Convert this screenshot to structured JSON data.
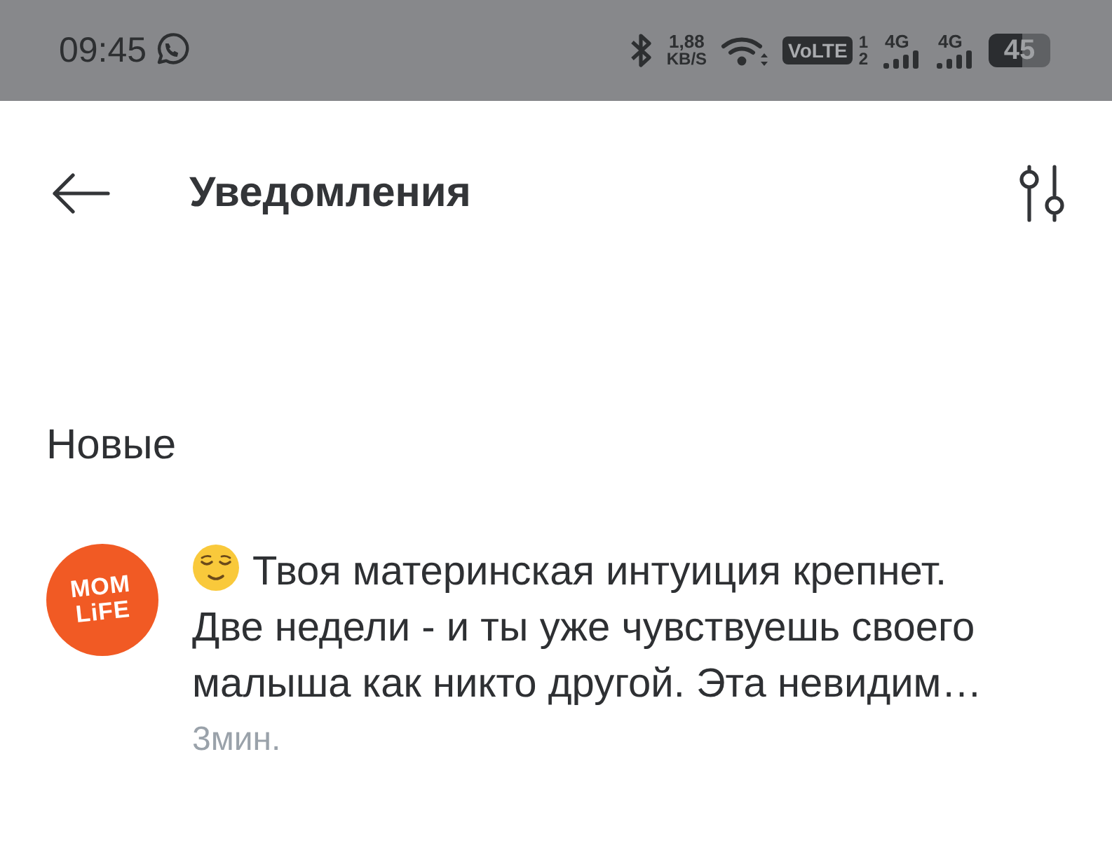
{
  "status_bar": {
    "time": "09:45",
    "data_rate": "1,88",
    "data_rate_unit": "KB/S",
    "volte": "VoLTE",
    "sim_slots": [
      "1",
      "2"
    ],
    "networks": [
      {
        "label": "4G"
      },
      {
        "label": "4G"
      }
    ],
    "battery": "45"
  },
  "header": {
    "title": "Уведомления"
  },
  "sections": [
    {
      "title": "Новые",
      "notifications": [
        {
          "logo": [
            "MOM",
            "LiFE"
          ],
          "text": "Твоя материнская интуиция крепнет. Две недели - и ты уже чувствуешь своего малыша как никто другой. Эта невидим…",
          "time": "3мин."
        }
      ]
    }
  ]
}
